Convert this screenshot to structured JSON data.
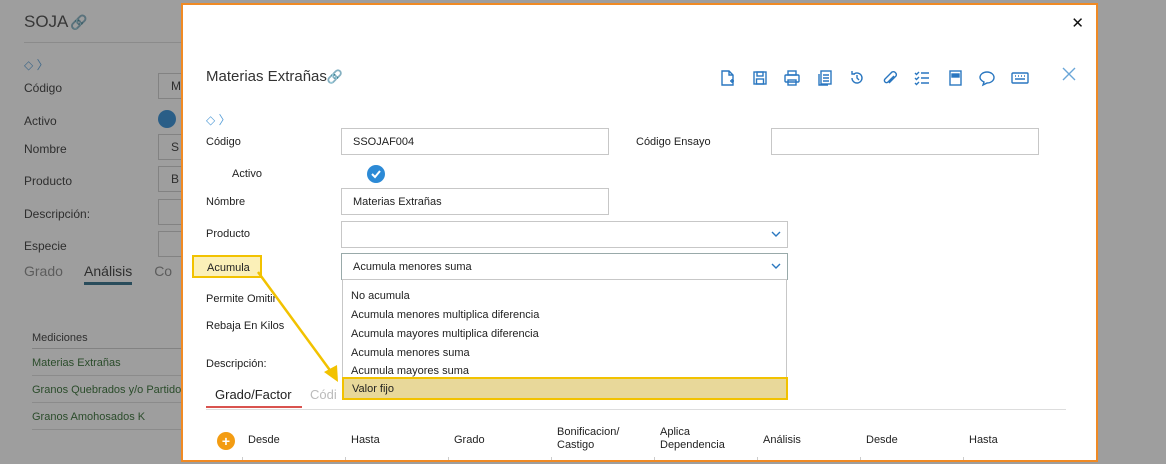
{
  "background": {
    "title": "SOJA",
    "labels": [
      "Código",
      "Activo",
      "Nombre",
      "Producto",
      "Descripción:",
      "Especie"
    ],
    "input_fragments": [
      "M",
      "S",
      "B"
    ],
    "tabs": [
      "Grado",
      "Análisis",
      "Co"
    ],
    "list_header": "Mediciones",
    "list_items": [
      "Materias Extrañas",
      "Granos Quebrados y/o Partidos",
      "Granos Amohosados K"
    ]
  },
  "modal": {
    "close_glyph": "✕",
    "title": "Materias Extrañas",
    "toolbar_icons": [
      "new-document-icon",
      "save-icon",
      "print-icon",
      "copy-icon",
      "history-icon",
      "attach-icon",
      "checklist-icon",
      "book-icon",
      "comment-icon",
      "keyboard-icon"
    ],
    "labels": {
      "codigo": "Código",
      "codigo_ensayo": "Código Ensayo",
      "activo": "Activo",
      "nombre": "Nómbre",
      "producto": "Producto",
      "acumula": "Acumula",
      "permite_omitir": "Permite Omitir",
      "rebaja_kilos": "Rebaja En Kilos",
      "descripcion": "Descripción:"
    },
    "values": {
      "codigo": "SSOJAF004",
      "codigo_ensayo": "",
      "nombre": "Materias Extrañas",
      "producto": "",
      "acumula": "Acumula menores suma"
    },
    "acumula_options": [
      "No acumula",
      "Acumula menores multiplica diferencia",
      "Acumula mayores multiplica diferencia",
      "Acumula menores suma",
      "Acumula mayores suma",
      "Valor fijo"
    ],
    "acumula_highlighted": "Valor fijo",
    "tabs": [
      "Grado/Factor",
      "Códi"
    ],
    "grid_columns": [
      "Desde",
      "Hasta",
      "Grado",
      "Bonificacion/ Castigo",
      "Aplica Dependencia",
      "Análisis",
      "Desde",
      "Hasta"
    ],
    "accent_color": "#f08a24",
    "highlight_color": "#f2c200",
    "icon_color": "#2a77c0"
  }
}
